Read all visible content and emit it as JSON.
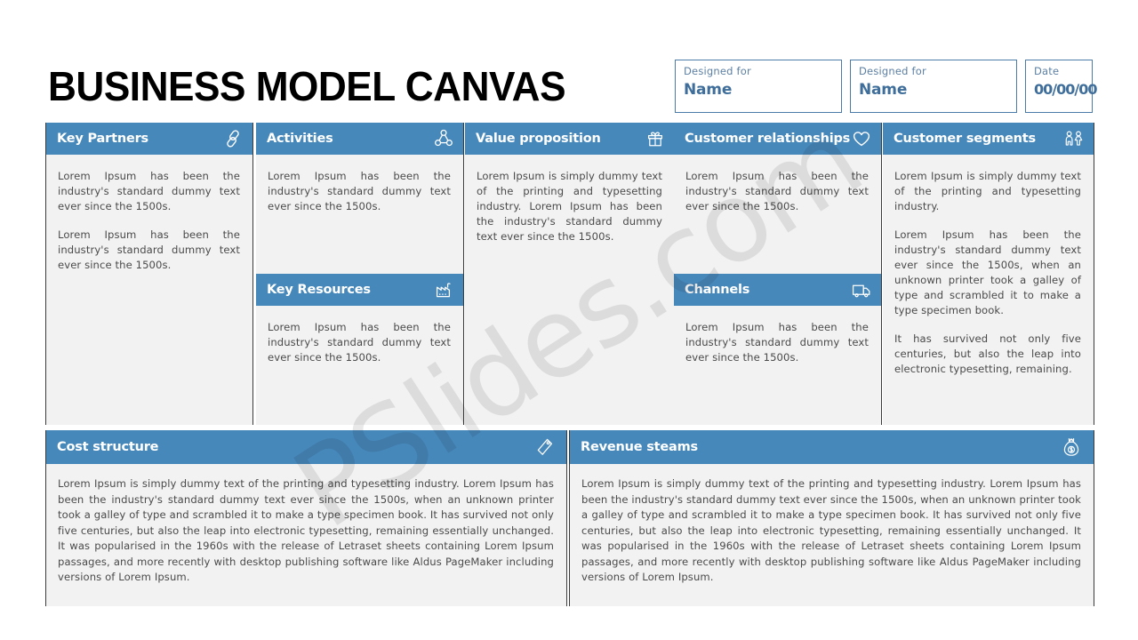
{
  "title": "BUSINESS MODEL CANVAS",
  "watermark": "PSlides.com",
  "colors": {
    "header_blue": "#4788bb",
    "panel_bg": "#f2f2f2",
    "meta_border": "#4b7ba8",
    "meta_value": "#3f6e9b",
    "body_text": "#4a4a4a"
  },
  "meta": [
    {
      "label": "Designed for",
      "value": "Name"
    },
    {
      "label": "Designed for",
      "value": "Name"
    },
    {
      "label": "Date",
      "value": "00/00/00"
    }
  ],
  "columns": [
    {
      "panels": [
        {
          "title": "Key Partners",
          "icon": "chain-link-icon",
          "paragraphs": [
            "Lorem Ipsum has been the industry's standard dummy text ever since the 1500s.",
            "Lorem Ipsum has been the industry's standard dummy text ever since the 1500s."
          ]
        }
      ]
    },
    {
      "panels": [
        {
          "title": "Activities",
          "icon": "network-nodes-icon",
          "paragraphs": [
            "Lorem Ipsum has been the industry's standard dummy text ever since the 1500s."
          ]
        },
        {
          "title": "Key Resources",
          "icon": "factory-icon",
          "paragraphs": [
            "Lorem Ipsum has been the industry's standard dummy text ever since the 1500s."
          ]
        }
      ]
    },
    {
      "panels": [
        {
          "title": "Value proposition",
          "icon": "gift-box-icon",
          "paragraphs": [
            "Lorem Ipsum is simply dummy text of the printing and typesetting industry. Lorem Ipsum has been the industry's standard dummy text ever since the 1500s."
          ]
        }
      ]
    },
    {
      "panels": [
        {
          "title": "Customer relationships",
          "icon": "heart-icon",
          "paragraphs": [
            "Lorem Ipsum has been the industry's standard dummy text ever since the 1500s."
          ]
        },
        {
          "title": "Channels",
          "icon": "delivery-truck-icon",
          "paragraphs": [
            "Lorem Ipsum has been the industry's standard dummy text ever since the 1500s."
          ]
        }
      ]
    },
    {
      "panels": [
        {
          "title": "Customer segments",
          "icon": "people-icon",
          "paragraphs": [
            "Lorem Ipsum is simply dummy text of the printing and typesetting industry.",
            "Lorem Ipsum has been the industry's standard dummy text ever since the 1500s, when an unknown printer took a galley of type and scrambled it to make a type specimen book.",
            " It has survived not only five centuries, but also the leap into electronic typesetting, remaining."
          ]
        }
      ]
    }
  ],
  "bottom": [
    {
      "title": "Cost structure",
      "icon": "price-tag-icon",
      "paragraphs": [
        "Lorem Ipsum is simply dummy text of the printing and typesetting industry. Lorem Ipsum has been the industry's standard dummy text ever since the 1500s, when an unknown printer took a galley of type and scrambled it to make a type specimen book. It has survived not only five centuries, but also the leap into electronic typesetting, remaining essentially unchanged. It was popularised in the 1960s with the release of Letraset sheets containing Lorem Ipsum passages, and more recently with desktop publishing software like Aldus PageMaker including versions of Lorem Ipsum."
      ]
    },
    {
      "title": "Revenue steams",
      "icon": "money-bag-icon",
      "paragraphs": [
        "Lorem Ipsum is simply dummy text of the printing and typesetting industry. Lorem Ipsum has been the industry's standard dummy text ever since the 1500s, when an unknown printer took a galley of type and scrambled it to make a type specimen book. It has survived not only five centuries, but also the leap into electronic typesetting, remaining essentially unchanged. It was popularised in the 1960s with the release of Letraset sheets containing Lorem Ipsum passages, and more recently with desktop publishing software like Aldus PageMaker including versions of Lorem Ipsum."
      ]
    }
  ]
}
